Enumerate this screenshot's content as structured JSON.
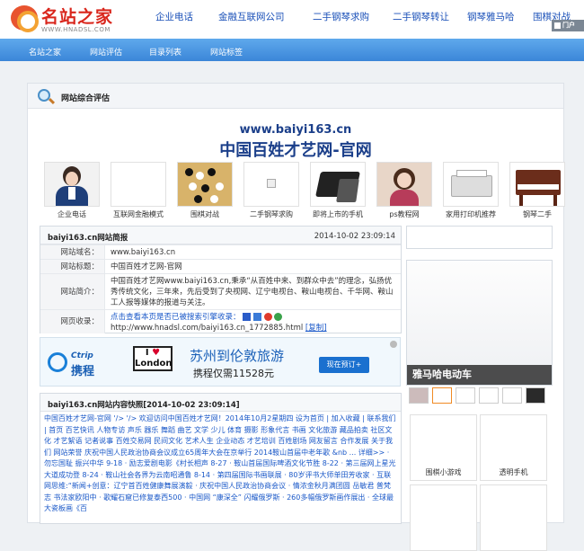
{
  "logo": {
    "name": "名站之家",
    "url": "WWW.HNADSL.COM"
  },
  "topnav": [
    "企业电话",
    "金融互联网公司",
    "二手钢琴求购",
    "二手钢琴转让",
    "钢琴雅马哈",
    "围棋对战"
  ],
  "mini_label": "门户",
  "nav": [
    "名站之家",
    "网站评估",
    "目录列表",
    "网站标签"
  ],
  "section_title": "网站综合评估",
  "site": {
    "domain": "www.baiyi163.cn",
    "title": "中国百姓才艺网-官网"
  },
  "thumbs": [
    "企业电话",
    "互联网金融模式",
    "围棋对战",
    "二手钢琴求购",
    "即将上市的手机",
    "ps教程网",
    "家用打印机推荐",
    "钢琴二手"
  ],
  "brief": {
    "header": "baiyi163.cn网站简报",
    "date": "2014-10-02 23:09:14",
    "rows": [
      {
        "label": "网站域名：",
        "value": "www.baiyi163.cn"
      },
      {
        "label": "网站标题：",
        "value": "中国百姓才艺网-官网"
      },
      {
        "label": "网站简介：",
        "value": "中国百姓才艺网www.baiyi163.cn,秉承“从百姓中来、到群众中去”的理念，弘扬优秀传统文化，三年来，先后受到了央视网、辽宁电视台、鞍山电视台、千华网、鞍山工人报等媒体的报道与关注。"
      },
      {
        "label": "网页收录：",
        "value": "点击查看本页是否已被搜索引擎收录："
      }
    ],
    "link": "http://www.hnadsl.com/baiyi163.cn_1772885.html",
    "copy": "[复制]"
  },
  "ad": {
    "brand_en": "Ctrip",
    "brand_cn": "携程",
    "love": "I",
    "heart": "♥",
    "city": "London",
    "title": "苏州到伦敦旅游",
    "sub": "携程仅需11528元",
    "button": "现在预订+"
  },
  "snapshot": {
    "header": "baiyi163.cn网站内容快照[2014-10-02 23:09:14]",
    "text": "中国百姓才艺网-官网 '/> '/> 欢迎访问中国百姓才艺网！2014年10月2星期四 设为首页 | 加入收藏 | 联系我们 | 首页 百艺快讯 人物专访 声乐 器乐 舞蹈 曲艺 文学 少儿 体育 摄影 形象代言 书画 文化旅游 藏品拍卖 社区文化 才艺絮语 记者说事 百姓交易网 民间文化 艺术人生 企业动态 才艺培训 百姓剧场 网友留言 合作发展 关于我们 网站荣誉 庆祝中国人民政治协商会议成立65周年大会在京举行 2014鞍山首届中老年歌 &nb ... 详细>> · 勿忘国耻 振兴中华 9-18 · 励志爱剧电影《村长相声 8-27 · 鞍山首届国际啤酒文化节胜 8-22 · 第三届网上星光大道成功登 8-24 · 鞍山社会各界为云南昭通鲁 8-14 · 第四届国际书画联展 · 80岁评书大师单田芳收家 · 互联网思维:“新闻+创意：辽宁首百姓健康舞展演毅 · 庆祝中国人民政治协商会议 · 情浓金秋月满团圆 岳敏君 普梵志 书法家欧阳中 · 歌耀石窟已修复泰西500 · 中国网 “康深全” 闪耀俄罗斯 · 260多幅俄罗斯画作展出 · 全球最大瓷板画《百"
  },
  "side": {
    "tag": "雅马哈电动车"
  },
  "grid": [
    "围棋小游戏",
    "透明手机"
  ]
}
